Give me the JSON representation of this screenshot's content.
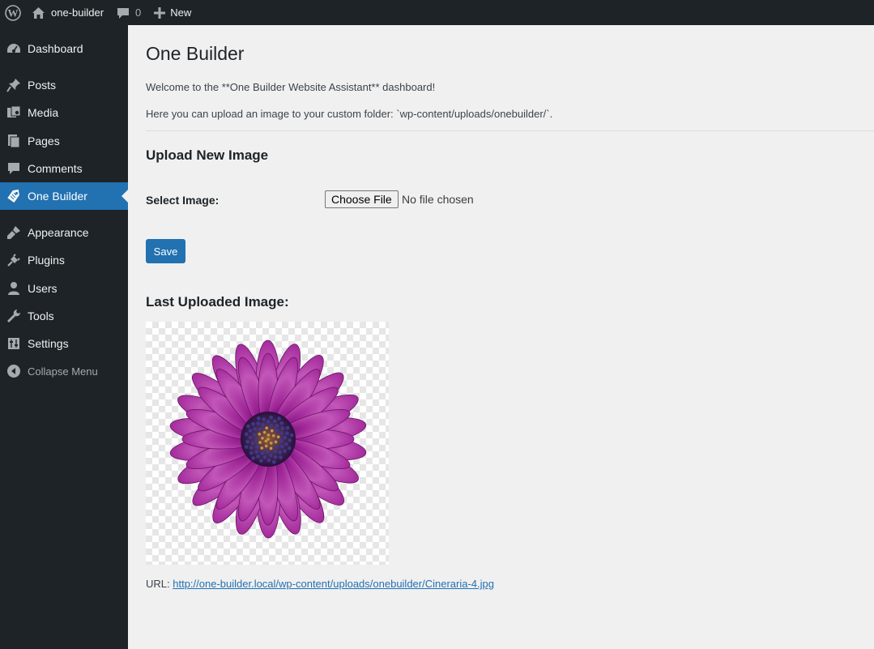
{
  "adminbar": {
    "site_name": "one-builder",
    "comments_count": "0",
    "new_label": "New"
  },
  "menu": {
    "items": [
      {
        "label": "Dashboard",
        "icon": "dashboard-icon"
      },
      {
        "label": "Posts",
        "icon": "pin-icon"
      },
      {
        "label": "Media",
        "icon": "media-icon"
      },
      {
        "label": "Pages",
        "icon": "pages-icon"
      },
      {
        "label": "Comments",
        "icon": "comment-icon"
      },
      {
        "label": "One Builder",
        "icon": "tag-icon",
        "current": true
      },
      {
        "label": "Appearance",
        "icon": "brush-icon"
      },
      {
        "label": "Plugins",
        "icon": "plug-icon"
      },
      {
        "label": "Users",
        "icon": "user-icon"
      },
      {
        "label": "Tools",
        "icon": "wrench-icon"
      },
      {
        "label": "Settings",
        "icon": "sliders-icon"
      },
      {
        "label": "Collapse Menu",
        "icon": "collapse-icon"
      }
    ]
  },
  "page": {
    "title": "One Builder",
    "intro1": "Welcome to the **One Builder Website Assistant** dashboard!",
    "intro2": "Here you can upload an image to your custom folder: `wp-content/uploads/onebuilder/`.",
    "upload_heading": "Upload New Image",
    "select_label": "Select Image:",
    "choose_file": "Choose File",
    "no_file": "No file chosen",
    "save": "Save",
    "last_heading": "Last Uploaded Image:",
    "url_label": "URL: ",
    "url": "http://one-builder.local/wp-content/uploads/onebuilder/Cineraria-4.jpg"
  },
  "colors": {
    "adminbar_bg": "#1d2327",
    "accent": "#2271b1",
    "content_bg": "#f0f0f1",
    "flower": "#a6259a"
  }
}
